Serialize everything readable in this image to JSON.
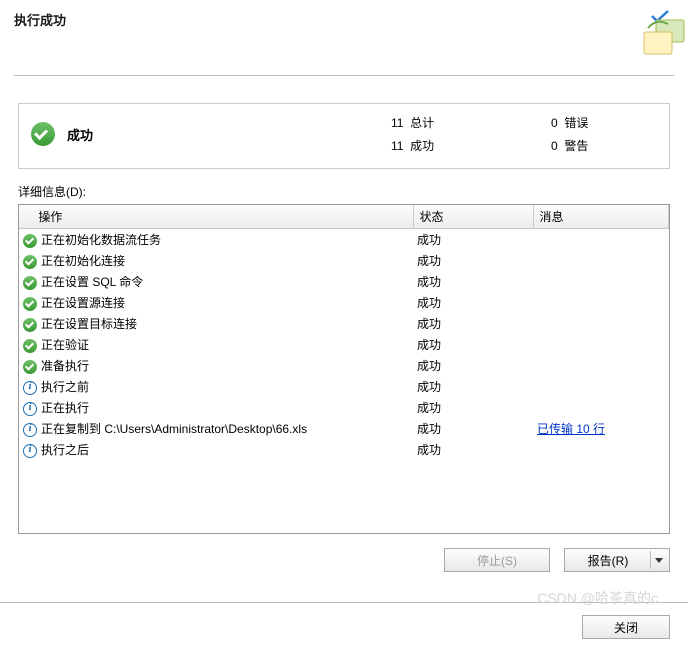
{
  "header": {
    "title": "执行成功"
  },
  "summary": {
    "status_label": "成功",
    "total_count": "11",
    "total_label": "总计",
    "success_count": "11",
    "success_label": "成功",
    "error_count": "0",
    "error_label": "错误",
    "warning_count": "0",
    "warning_label": "警告"
  },
  "details_label": "详细信息(D):",
  "columns": {
    "action": "操作",
    "status": "状态",
    "message": "消息"
  },
  "rows": [
    {
      "icon": "success",
      "action": "正在初始化数据流任务",
      "status": "成功",
      "message": ""
    },
    {
      "icon": "success",
      "action": "正在初始化连接",
      "status": "成功",
      "message": ""
    },
    {
      "icon": "success",
      "action": "正在设置 SQL 命令",
      "status": "成功",
      "message": ""
    },
    {
      "icon": "success",
      "action": "正在设置源连接",
      "status": "成功",
      "message": ""
    },
    {
      "icon": "success",
      "action": "正在设置目标连接",
      "status": "成功",
      "message": ""
    },
    {
      "icon": "success",
      "action": "正在验证",
      "status": "成功",
      "message": ""
    },
    {
      "icon": "success",
      "action": "准备执行",
      "status": "成功",
      "message": ""
    },
    {
      "icon": "info",
      "action": "执行之前",
      "status": "成功",
      "message": ""
    },
    {
      "icon": "info",
      "action": "正在执行",
      "status": "成功",
      "message": ""
    },
    {
      "icon": "info",
      "action": "正在复制到 C:\\Users\\Administrator\\Desktop\\66.xls",
      "status": "成功",
      "message": "已传输 10 行",
      "link": true
    },
    {
      "icon": "info",
      "action": "执行之后",
      "status": "成功",
      "message": ""
    }
  ],
  "buttons": {
    "stop": "停止(S)",
    "report": "报告(R)",
    "close": "关闭"
  },
  "watermark": "CSDN @哈茶真的c"
}
